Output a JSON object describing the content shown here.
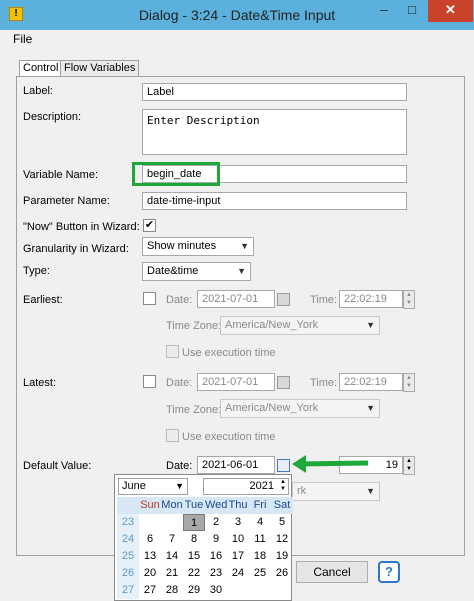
{
  "window": {
    "title": "Dialog - 3:24 - Date&Time Input",
    "app_icon_glyph": "!",
    "minimize": "–",
    "maximize": "□",
    "close": "✕"
  },
  "menu": {
    "file": "File"
  },
  "tabs": [
    {
      "label": "Control"
    },
    {
      "label": "Flow Variables"
    }
  ],
  "form": {
    "label": {
      "label": "Label:",
      "value": "Label"
    },
    "description": {
      "label": "Description:",
      "value": "Enter Description"
    },
    "variable_name": {
      "label": "Variable Name:",
      "value": "begin_date"
    },
    "parameter_name": {
      "label": "Parameter Name:",
      "value": "date-time-input"
    },
    "now_button": {
      "label": "\"Now\" Button in Wizard:",
      "checked": true,
      "mark": "✔"
    },
    "granularity": {
      "label": "Granularity in Wizard:",
      "value": "Show minutes"
    },
    "type": {
      "label": "Type:",
      "value": "Date&time"
    },
    "earliest": {
      "label": "Earliest:",
      "date_label": "Date:",
      "date": "2021-07-01",
      "time_label": "Time:",
      "time": "22:02:19",
      "timezone_label": "Time Zone:",
      "timezone": "America/New_York",
      "use_exec_time": "Use execution time"
    },
    "latest": {
      "label": "Latest:",
      "date_label": "Date:",
      "date": "2021-07-01",
      "time_label": "Time:",
      "time": "22:02:19",
      "timezone_label": "Time Zone:",
      "timezone": "America/New_York",
      "use_exec_time": "Use execution time"
    },
    "default_value": {
      "label": "Default Value:",
      "date_label": "Date:",
      "date": "2021-06-01",
      "time": "19",
      "timezone_partial": "rk"
    }
  },
  "calendar": {
    "month": "June",
    "year": "2021",
    "day_headers": [
      "Sun",
      "Mon",
      "Tue",
      "Wed",
      "Thu",
      "Fri",
      "Sat"
    ],
    "weeks": [
      {
        "week": "23",
        "days": [
          "",
          "",
          "1",
          "2",
          "3",
          "4",
          "5"
        ]
      },
      {
        "week": "24",
        "days": [
          "6",
          "7",
          "8",
          "9",
          "10",
          "11",
          "12"
        ]
      },
      {
        "week": "25",
        "days": [
          "13",
          "14",
          "15",
          "16",
          "17",
          "18",
          "19"
        ]
      },
      {
        "week": "26",
        "days": [
          "20",
          "21",
          "22",
          "23",
          "24",
          "25",
          "26"
        ]
      },
      {
        "week": "27",
        "days": [
          "27",
          "28",
          "29",
          "30",
          "",
          "",
          ""
        ]
      }
    ],
    "selected_day": "1"
  },
  "buttons": {
    "cancel": "Cancel",
    "help": "?"
  },
  "colors": {
    "highlight": "#1fa83a",
    "titlebar": "#5bb0dc",
    "close": "#c9432b"
  }
}
